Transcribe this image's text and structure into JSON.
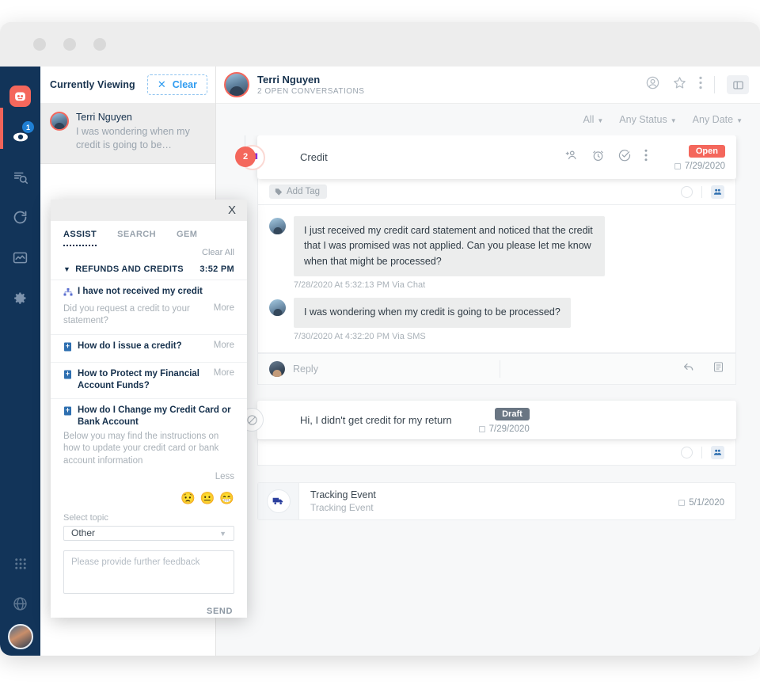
{
  "window": {
    "dots": 3
  },
  "rail": {
    "items": [
      {
        "name": "logo",
        "icon": "robot-logo-icon",
        "badge": null
      },
      {
        "name": "viewing",
        "icon": "eye-icon",
        "badge": "1"
      },
      {
        "name": "search",
        "icon": "filter-search-icon",
        "badge": null
      },
      {
        "name": "refresh",
        "icon": "sync-icon",
        "badge": null
      },
      {
        "name": "analytics",
        "icon": "analytics-icon",
        "badge": null
      },
      {
        "name": "settings",
        "icon": "gear-icon",
        "badge": null
      },
      {
        "name": "apps",
        "icon": "grid-apps-icon",
        "badge": null
      },
      {
        "name": "help",
        "icon": "globe-help-icon",
        "badge": null
      }
    ]
  },
  "list_panel": {
    "title": "Currently Viewing",
    "clear_label": "Clear",
    "clear_icon": "close-icon",
    "conversations": [
      {
        "name": "Terri Nguyen",
        "snippet": "I was wondering when my credit is going to be…"
      }
    ]
  },
  "header": {
    "customer_name": "Terri Nguyen",
    "subtitle": "2 OPEN CONVERSATIONS",
    "actions": [
      "profile-icon",
      "star-icon",
      "overflow-menu-icon",
      "panel-toggle-icon"
    ]
  },
  "filters": [
    {
      "label": "All"
    },
    {
      "label": "Any Status"
    },
    {
      "label": "Any Date"
    }
  ],
  "stream": {
    "add_button_label": "+",
    "count_badge": "2",
    "thread": {
      "title": "Credit",
      "channel_icon": "chat-bubble-icon",
      "actions": [
        "add-people-icon",
        "snooze-alarm-icon",
        "resolve-check-icon",
        "overflow-menu-icon"
      ],
      "status_badge": "Open",
      "date": "7/29/2020",
      "tag_placeholder": "Add Tag",
      "tag_icon": "tag-icon",
      "messages": [
        {
          "text": "I just received my credit card statement and noticed that the credit that I was promised was not applied. Can you please let me know when that might be processed?",
          "meta": "7/28/2020 At 5:32:13 PM Via Chat"
        },
        {
          "text": "I was wondering when my credit is going to be processed?",
          "meta": "7/30/2020 At 4:32:20 PM Via SMS"
        }
      ],
      "reply_placeholder": "Reply",
      "reply_actions": [
        "reply-arrow-icon",
        "note-icon"
      ]
    },
    "draft": {
      "text": "Hi, I didn't get credit for my return",
      "badge": "Draft",
      "date": "7/29/2020",
      "status_icon": "blocked-circle-icon"
    },
    "tracking": {
      "title": "Tracking Event",
      "subtitle": "Tracking Event",
      "date": "5/1/2020",
      "icon": "delivery-truck-icon"
    }
  },
  "assist": {
    "close_label": "X",
    "tabs": [
      {
        "label": "ASSIST",
        "active": true
      },
      {
        "label": "SEARCH",
        "active": false
      },
      {
        "label": "GEM",
        "active": false
      }
    ],
    "clear_all": "Clear All",
    "group": {
      "label": "REFUNDS AND CREDITS",
      "time": "3:52 PM"
    },
    "items": [
      {
        "title": "I have not received my credit",
        "icon": "flow-tree-icon",
        "desc": "Did you request a credit to your statement?",
        "link": "More"
      },
      {
        "title": "How do I issue a credit?",
        "icon": "article-icon",
        "desc": "",
        "link": "More"
      },
      {
        "title": "How to Protect my Financial Account Funds?",
        "icon": "article-icon",
        "desc": "",
        "link": "More"
      },
      {
        "title": "How do I Change my Credit Card or Bank Account",
        "icon": "article-icon",
        "desc": "Below you may find the instructions on how to update your credit card or bank account information",
        "link": "Less"
      }
    ],
    "emojis": [
      "😟",
      "😐",
      "😁"
    ],
    "select_label": "Select topic",
    "select_value": "Other",
    "feedback_placeholder": "Please provide further feedback",
    "send_label": "SEND"
  },
  "colors": {
    "rail_bg": "#123459",
    "accent_red": "#f4675c",
    "accent_blue": "#2e9bf0",
    "draft_gray": "#6a7683",
    "navy_text": "#16314d"
  }
}
